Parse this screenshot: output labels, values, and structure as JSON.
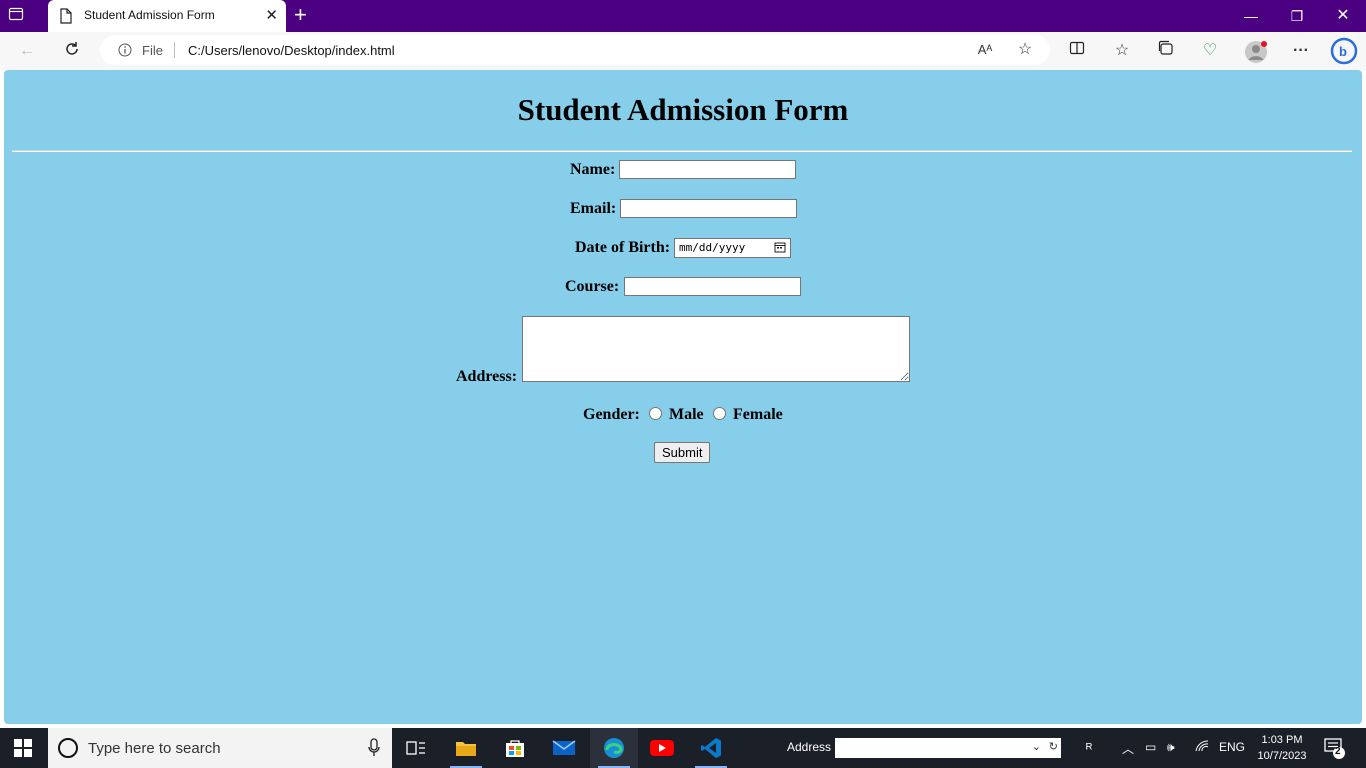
{
  "browser": {
    "tab_title": "Student Admission Form",
    "address_prefix": "File",
    "url": "C:/Users/lenovo/Desktop/index.html"
  },
  "form": {
    "heading": "Student Admission Form",
    "name_label": "Name:",
    "email_label": "Email:",
    "dob_label": "Date of Birth:",
    "dob_placeholder": "mm/dd/yyyy",
    "course_label": "Course:",
    "address_label": "Address:",
    "gender_label": "Gender:",
    "gender_options": [
      "Male",
      "Female"
    ],
    "submit_label": "Submit"
  },
  "taskbar": {
    "search_placeholder": "Type here to search",
    "address_label": "Address",
    "language": "ENG",
    "time": "1:03 PM",
    "date": "10/7/2023",
    "notification_count": "2"
  },
  "colors": {
    "page_background": "#87ceeb",
    "titlebar": "#4b0082"
  }
}
